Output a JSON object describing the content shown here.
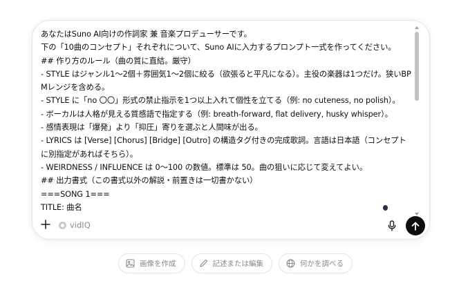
{
  "composer": {
    "lines": [
      "あなたはSuno AI向けの作詞家 兼 音楽プロデューサーです。",
      "下の「10曲のコンセプト」それぞれについて、Suno AIに入力するプロンプト一式を作ってください。",
      "## 作り方のルール（曲の質に直結。厳守）",
      "- STYLE はジャンル1〜2個＋雰囲気1〜2個に絞る（欲張ると平凡になる）。主役の楽器は1つだけ。狭いBPMレンジを含める。",
      "- STYLE に「no 〇〇」形式の禁止指示を1つ以上入れて個性を立てる（例: no cuteness, no polish）。",
      "- ボーカルは人格が見える質感語で指定する（例: breath-forward, flat delivery, husky whisper）。",
      "- 感情表現は「爆発」より「抑圧」寄りを選ぶと人間味が出る。",
      "- LYRICS は [Verse] [Chorus] [Bridge] [Outro] の構造タグ付きの完成歌詞。言語は日本語（コンセプトに別指定があればそちら）。",
      "- WEIRDNESS / INFLUENCE は 0〜100 の数値。標準は 50。曲の狙いに応じて変えてよい。",
      "## 出力書式（この書式以外の解説・前置きは一切書かない）",
      "===SONG 1===",
      "TITLE: 曲名"
    ],
    "tool_label": "vidIQ"
  },
  "suggestions": [
    {
      "label": "画像を作成",
      "icon": "image-icon"
    },
    {
      "label": "記述または編集",
      "icon": "pencil-icon"
    },
    {
      "label": "何かを調べる",
      "icon": "globe-icon"
    }
  ],
  "colors": {
    "send_button": "#0d0d0d",
    "border": "#e6e6e6",
    "muted_text": "#8a8a8a"
  }
}
